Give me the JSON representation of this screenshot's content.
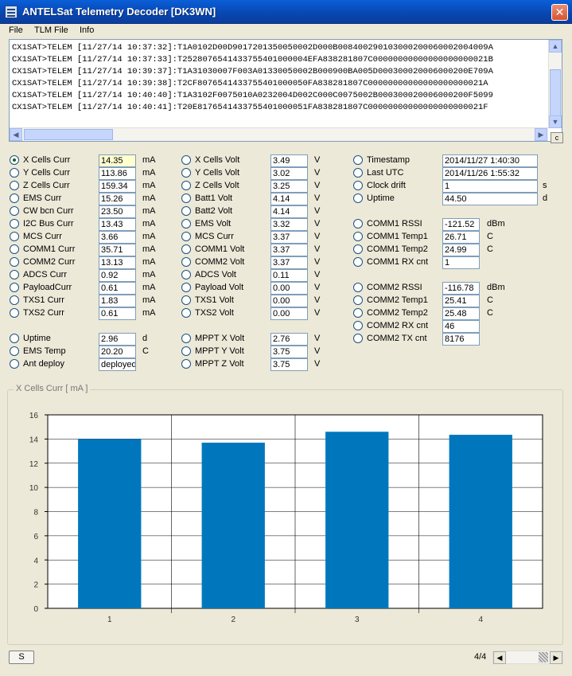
{
  "window": {
    "title": "ANTELSat Telemetry Decoder [DK3WN]"
  },
  "menu": [
    "File",
    "TLM File",
    "Info"
  ],
  "log": [
    "CX1SAT>TELEM [11/27/14 10:37:32]:T1A0102D00D9017201350050002D000B008400290103000200060002004009A",
    "CX1SAT>TELEM [11/27/14 10:37:33]:T2528076541433755401000004EFA838281807C00000000000000000000021B",
    "CX1SAT>TELEM [11/27/14 10:39:37]:T1A31030007F003A01330050002B000900BA005D000300020006000200E709A",
    "CX1SAT>TELEM [11/27/14 10:39:38]:T2CF8076541433755401000050FA838281807C00000000000000000000021A",
    "CX1SAT>TELEM [11/27/14 10:40:40]:T1A3102F0075010A0232004D002C000C0075002B000300020006000200F5099",
    "CX1SAT>TELEM [11/27/14 10:40:41]:T20E8176541433755401000051FA838281807C00000000000000000000021F"
  ],
  "col1": [
    {
      "label": "X Cells Curr",
      "value": "14.35",
      "unit": "mA",
      "checked": true
    },
    {
      "label": "Y Cells Curr",
      "value": "113.86",
      "unit": "mA"
    },
    {
      "label": "Z Cells Curr",
      "value": "159.34",
      "unit": "mA"
    },
    {
      "label": "EMS Curr",
      "value": "15.26",
      "unit": "mA"
    },
    {
      "label": "CW bcn Curr",
      "value": "23.50",
      "unit": "mA"
    },
    {
      "label": "I2C Bus Curr",
      "value": "13.43",
      "unit": "mA"
    },
    {
      "label": "MCS Curr",
      "value": "3.66",
      "unit": "mA"
    },
    {
      "label": "COMM1 Curr",
      "value": "35.71",
      "unit": "mA"
    },
    {
      "label": "COMM2 Curr",
      "value": "13.13",
      "unit": "mA"
    },
    {
      "label": "ADCS Curr",
      "value": "0.92",
      "unit": "mA"
    },
    {
      "label": "PayloadCurr",
      "value": "0.61",
      "unit": "mA"
    },
    {
      "label": "TXS1 Curr",
      "value": "1.83",
      "unit": "mA"
    },
    {
      "label": "TXS2 Curr",
      "value": "0.61",
      "unit": "mA"
    }
  ],
  "col1b": [
    {
      "label": "Uptime",
      "value": "2.96",
      "unit": "d"
    },
    {
      "label": "EMS Temp",
      "value": "20.20",
      "unit": "C"
    },
    {
      "label": "Ant deploy",
      "value": "deployed",
      "unit": ""
    }
  ],
  "col2": [
    {
      "label": "X Cells Volt",
      "value": "3.49",
      "unit": "V"
    },
    {
      "label": "Y Cells Volt",
      "value": "3.02",
      "unit": "V"
    },
    {
      "label": "Z Cells Volt",
      "value": "3.25",
      "unit": "V"
    },
    {
      "label": "Batt1 Volt",
      "value": "4.14",
      "unit": "V"
    },
    {
      "label": "Batt2 Volt",
      "value": "4.14",
      "unit": "V"
    },
    {
      "label": "EMS Volt",
      "value": "3.32",
      "unit": "V"
    },
    {
      "label": "MCS Curr",
      "value": "3.37",
      "unit": "V"
    },
    {
      "label": "COMM1 Volt",
      "value": "3.37",
      "unit": "V"
    },
    {
      "label": "COMM2 Volt",
      "value": "3.37",
      "unit": "V"
    },
    {
      "label": "ADCS Volt",
      "value": "0.11",
      "unit": "V"
    },
    {
      "label": "Payload Volt",
      "value": "0.00",
      "unit": "V"
    },
    {
      "label": "TXS1 Volt",
      "value": "0.00",
      "unit": "V"
    },
    {
      "label": "TXS2 Volt",
      "value": "0.00",
      "unit": "V"
    }
  ],
  "col2b": [
    {
      "label": "MPPT X Volt",
      "value": "2.76",
      "unit": "V"
    },
    {
      "label": "MPPT Y Volt",
      "value": "3.75",
      "unit": "V"
    },
    {
      "label": "MPPT Z Volt",
      "value": "3.75",
      "unit": "V"
    }
  ],
  "col3a": [
    {
      "label": "Timestamp",
      "value": "2014/11/27 1:40:30",
      "unit": ""
    },
    {
      "label": "Last UTC",
      "value": "2014/11/26 1:55:32",
      "unit": ""
    },
    {
      "label": "Clock drift",
      "value": "1",
      "unit": "s"
    },
    {
      "label": "Uptime",
      "value": "44.50",
      "unit": "d"
    }
  ],
  "col3b": [
    {
      "label": "COMM1 RSSI",
      "value": "-121.52",
      "unit": "dBm"
    },
    {
      "label": "COMM1 Temp1",
      "value": "26.71",
      "unit": "C"
    },
    {
      "label": "COMM1 Temp2",
      "value": "24.99",
      "unit": "C"
    },
    {
      "label": "COMM1 RX cnt",
      "value": "1",
      "unit": ""
    }
  ],
  "col3c": [
    {
      "label": "COMM2 RSSI",
      "value": "-116.78",
      "unit": "dBm"
    },
    {
      "label": "COMM2 Temp1",
      "value": "25.41",
      "unit": "C"
    },
    {
      "label": "COMM2 Temp2",
      "value": "25.48",
      "unit": "C"
    },
    {
      "label": "COMM2 RX cnt",
      "value": "46",
      "unit": ""
    },
    {
      "label": "COMM2 TX cnt",
      "value": "8176",
      "unit": ""
    }
  ],
  "chart_group_title": "X Cells Curr  [ mA ]",
  "chart_data": {
    "type": "bar",
    "categories": [
      "1",
      "2",
      "3",
      "4"
    ],
    "values": [
      14.0,
      13.7,
      14.6,
      14.35
    ],
    "ylim": [
      0,
      16
    ],
    "yticks": [
      "0",
      "2",
      "4",
      "6",
      "8",
      "10",
      "12",
      "14",
      "16"
    ],
    "grid": true,
    "bar_color": "#0077bd"
  },
  "bottom": {
    "s_button": "S",
    "page": "4/4"
  }
}
